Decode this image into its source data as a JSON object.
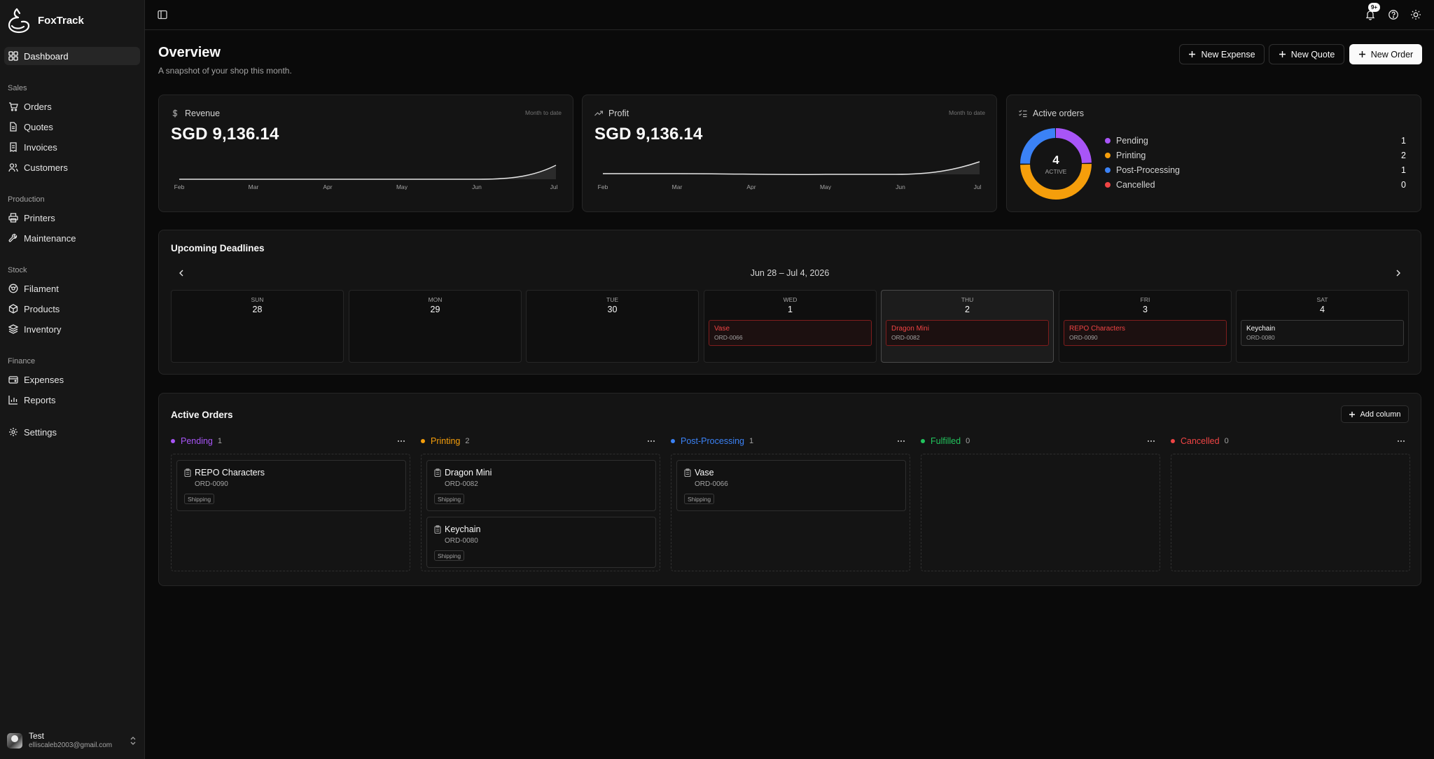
{
  "app": {
    "name": "FoxTrack"
  },
  "sidebar": {
    "dashboard": "Dashboard",
    "sections": {
      "sales": "Sales",
      "production": "Production",
      "stock": "Stock",
      "finance": "Finance"
    },
    "items": {
      "orders": "Orders",
      "quotes": "Quotes",
      "invoices": "Invoices",
      "customers": "Customers",
      "printers": "Printers",
      "maintenance": "Maintenance",
      "filament": "Filament",
      "products": "Products",
      "inventory": "Inventory",
      "expenses": "Expenses",
      "reports": "Reports",
      "settings": "Settings"
    },
    "user": {
      "name": "Test",
      "email": "elliscaleb2003@gmail.com"
    }
  },
  "topbar": {
    "notification_badge": "9+"
  },
  "header": {
    "title": "Overview",
    "subtitle": "A snapshot of your shop this month.",
    "buttons": {
      "new_expense": "New Expense",
      "new_quote": "New Quote",
      "new_order": "New Order"
    }
  },
  "revenue": {
    "label": "Revenue",
    "hint": "Month to date",
    "value": "SGD 9,136.14",
    "months": [
      "Feb",
      "Mar",
      "Apr",
      "May",
      "Jun",
      "Jul"
    ]
  },
  "profit": {
    "label": "Profit",
    "hint": "Month to date",
    "value": "SGD 9,136.14",
    "months": [
      "Feb",
      "Mar",
      "Apr",
      "May",
      "Jun",
      "Jul"
    ]
  },
  "active_orders": {
    "label": "Active orders",
    "total": "4",
    "total_caption": "ACTIVE",
    "legend": [
      {
        "name": "Pending",
        "count": "1",
        "color": "#a855f7"
      },
      {
        "name": "Printing",
        "count": "2",
        "color": "#f59e0b"
      },
      {
        "name": "Post-Processing",
        "count": "1",
        "color": "#3b82f6"
      },
      {
        "name": "Cancelled",
        "count": "0",
        "color": "#ef4444"
      }
    ]
  },
  "deadlines": {
    "title": "Upcoming Deadlines",
    "range": "Jun 28 – Jul 4, 2026",
    "days": [
      {
        "name": "SUN",
        "num": "28"
      },
      {
        "name": "MON",
        "num": "29"
      },
      {
        "name": "TUE",
        "num": "30"
      },
      {
        "name": "WED",
        "num": "1",
        "event": {
          "title": "Vase",
          "id": "ORD-0066"
        }
      },
      {
        "name": "THU",
        "num": "2",
        "event": {
          "title": "Dragon Mini",
          "id": "ORD-0082"
        }
      },
      {
        "name": "FRI",
        "num": "3",
        "event": {
          "title": "REPO Characters",
          "id": "ORD-0090"
        }
      },
      {
        "name": "SAT",
        "num": "4",
        "event": {
          "title": "Keychain",
          "id": "ORD-0080"
        }
      }
    ]
  },
  "kanban": {
    "title": "Active Orders",
    "add_column": "Add column",
    "columns": [
      {
        "name": "Pending",
        "count": "1",
        "color": "#a855f7",
        "cards": [
          {
            "title": "REPO Characters",
            "id": "ORD-0090",
            "tag": "Shipping"
          }
        ]
      },
      {
        "name": "Printing",
        "count": "2",
        "color": "#f59e0b",
        "cards": [
          {
            "title": "Dragon Mini",
            "id": "ORD-0082",
            "tag": "Shipping"
          },
          {
            "title": "Keychain",
            "id": "ORD-0080",
            "tag": "Shipping"
          }
        ]
      },
      {
        "name": "Post-Processing",
        "count": "1",
        "color": "#3b82f6",
        "cards": [
          {
            "title": "Vase",
            "id": "ORD-0066",
            "tag": "Shipping"
          }
        ]
      },
      {
        "name": "Fulfilled",
        "count": "0",
        "color": "#22c55e",
        "cards": []
      },
      {
        "name": "Cancelled",
        "count": "0",
        "color": "#ef4444",
        "cards": []
      }
    ]
  }
}
